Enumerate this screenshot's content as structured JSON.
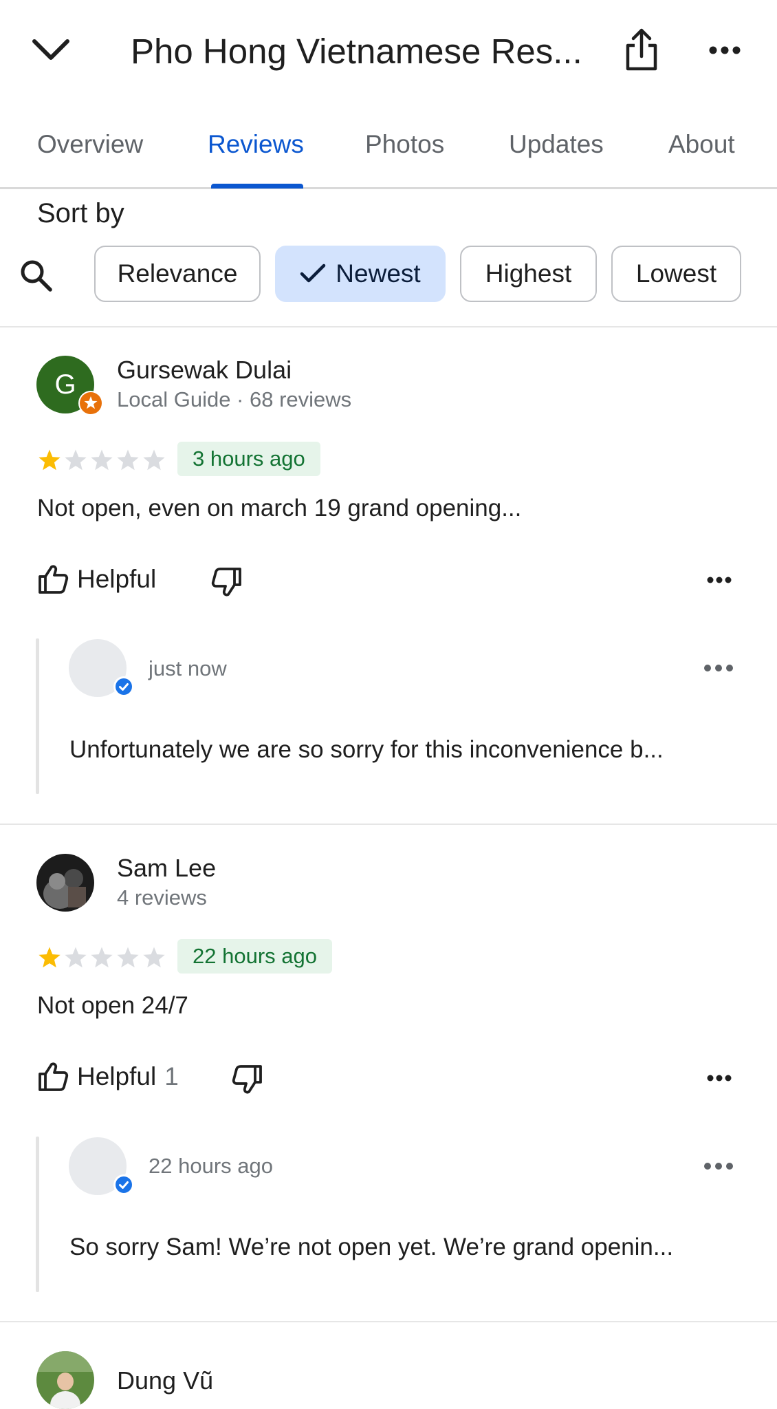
{
  "header": {
    "title": "Pho Hong Vietnamese Res...",
    "icons": [
      "chevron-down-icon",
      "share-icon",
      "more-icon"
    ]
  },
  "tabs": [
    {
      "label": "Overview",
      "active": false
    },
    {
      "label": "Reviews",
      "active": true
    },
    {
      "label": "Photos",
      "active": false
    },
    {
      "label": "Updates",
      "active": false
    },
    {
      "label": "About",
      "active": false
    }
  ],
  "sort": {
    "label": "Sort by",
    "options": [
      "Relevance",
      "Newest",
      "Highest",
      "Lowest"
    ],
    "selected": "Newest"
  },
  "reviews": [
    {
      "avatar_letter": "G",
      "avatar_color": "#2e6b1f",
      "name": "Gursewak Dulai",
      "subtitle": "Local Guide · 68 reviews",
      "rating": 1,
      "time": "3 hours ago",
      "text": "Not open, even on march 19 grand opening...",
      "helpful_label": "Helpful",
      "helpful_count": "",
      "reply": {
        "time": "just now",
        "text": "Unfortunately we are so sorry for this inconvenience b..."
      }
    },
    {
      "avatar_letter": "",
      "avatar_color": "#3a3a3a",
      "name": "Sam Lee",
      "subtitle": "4 reviews",
      "rating": 1,
      "time": "22 hours ago",
      "text": "Not open 24/7",
      "helpful_label": "Helpful",
      "helpful_count": "1",
      "reply": {
        "time": "22 hours ago",
        "text": "So sorry Sam! We’re not open yet. We’re grand openin..."
      }
    },
    {
      "avatar_letter": "",
      "avatar_color": "#4f7d3a",
      "name": "Dung Vũ"
    }
  ],
  "colors": {
    "accent": "#0b57d0",
    "star": "#fbbc04",
    "star_empty": "#dadce0",
    "badge_bg": "#e6f4ea",
    "badge_text": "#137333",
    "verified": "#1a73e8",
    "local_guide": "#e8710a"
  }
}
